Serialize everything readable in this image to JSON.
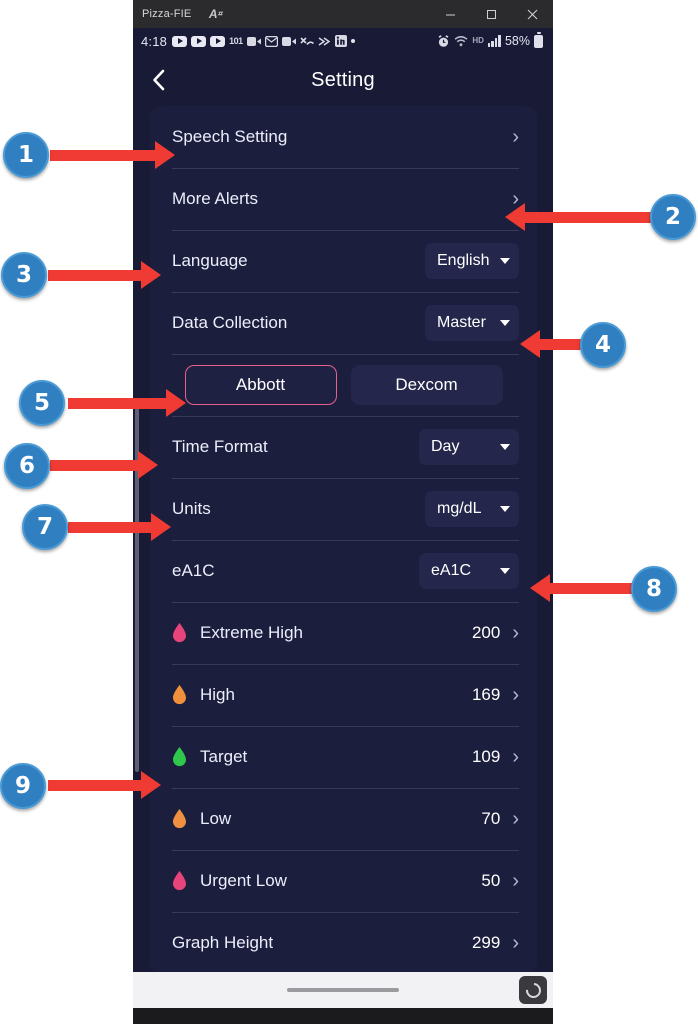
{
  "window": {
    "title": "Pizza-FIE",
    "app_icon": "app-icon",
    "minimize_label": "–",
    "maximize_label": "☐",
    "close_label": "✕"
  },
  "status_bar": {
    "time": "4:18",
    "icons": [
      "youtube-icon",
      "youtube-icon",
      "youtube-icon",
      "101-icon",
      "video-call-icon",
      "mail-icon",
      "video-call-icon",
      "missed-call-icon",
      "chevrons-icon",
      "linkedin-icon",
      "dot-icon"
    ],
    "alarm_icon": "alarm-icon",
    "wifi_icon": "wifi-icon",
    "hd_icon": "hd-icon",
    "signal_icon": "signal-bars-icon",
    "battery_percent": "58%",
    "battery_icon": "battery-icon"
  },
  "app_header": {
    "back_icon": "back-chevron-icon",
    "title": "Setting"
  },
  "settings": {
    "rows": [
      {
        "id": "speech-setting",
        "label": "Speech Setting",
        "type": "nav",
        "chevron": "›"
      },
      {
        "id": "more-alerts",
        "label": "More Alerts",
        "type": "nav",
        "chevron": "›"
      },
      {
        "id": "language",
        "label": "Language",
        "type": "dropdown",
        "value": "English"
      },
      {
        "id": "data-collection",
        "label": "Data Collection",
        "type": "dropdown",
        "value": "Master"
      },
      {
        "id": "time-format",
        "label": "Time Format",
        "type": "dropdown",
        "value": "Day"
      },
      {
        "id": "units",
        "label": "Units",
        "type": "dropdown",
        "value": "mg/dL"
      },
      {
        "id": "ea1c",
        "label": "eA1C",
        "type": "dropdown",
        "value": "eA1C"
      },
      {
        "id": "graph-height",
        "label": "Graph Height",
        "type": "value-nav",
        "value": "299",
        "chevron": "›"
      }
    ],
    "segmented": {
      "options": [
        {
          "id": "abbott",
          "label": "Abbott",
          "selected": true
        },
        {
          "id": "dexcom",
          "label": "Dexcom",
          "selected": false
        }
      ],
      "selected_border_color": "#e8608f"
    },
    "thresholds": [
      {
        "id": "extreme-high",
        "label": "Extreme High",
        "value": "200",
        "color": "#e8447c",
        "icon": "droplet-icon",
        "chevron": "›"
      },
      {
        "id": "high",
        "label": "High",
        "value": "169",
        "color": "#f0903c",
        "icon": "droplet-icon",
        "chevron": "›"
      },
      {
        "id": "target",
        "label": "Target",
        "value": "109",
        "color": "#2fc84a",
        "icon": "droplet-icon",
        "chevron": "›"
      },
      {
        "id": "low",
        "label": "Low",
        "value": "70",
        "color": "#ef9040",
        "icon": "droplet-icon",
        "chevron": "›"
      },
      {
        "id": "urgent-low",
        "label": "Urgent Low",
        "value": "50",
        "color": "#e8447c",
        "icon": "droplet-icon",
        "chevron": "›"
      }
    ]
  },
  "bottom_nav": {
    "gesture_pill": "gesture-pill",
    "floating_button_icon": "screen-record-icon"
  },
  "annotations": {
    "badge_color": "#2f7fc1",
    "arrow_color": "#ef3b33",
    "markers": [
      {
        "number": "1",
        "target": "Speech Setting"
      },
      {
        "number": "2",
        "target": "More Alerts"
      },
      {
        "number": "3",
        "target": "Language"
      },
      {
        "number": "4",
        "target": "Data Collection"
      },
      {
        "number": "5",
        "target": "Abbott"
      },
      {
        "number": "6",
        "target": "Time Format"
      },
      {
        "number": "7",
        "target": "Units"
      },
      {
        "number": "8",
        "target": "eA1C"
      },
      {
        "number": "9",
        "target": "Thresholds"
      }
    ]
  },
  "colors": {
    "page_bg": "#181a36",
    "card_bg": "#1c1e3d",
    "dropdown_bg": "#24274b",
    "text": "#ffffff"
  }
}
